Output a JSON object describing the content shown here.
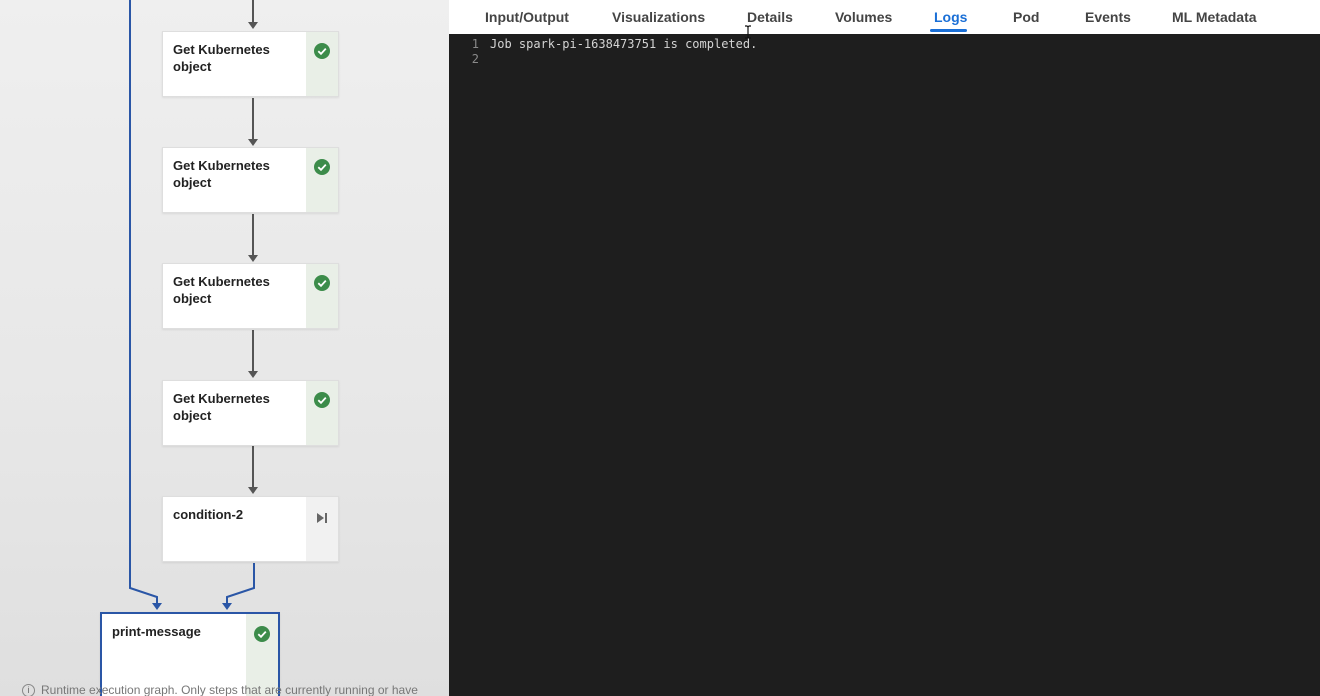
{
  "graph": {
    "nodes": [
      {
        "label": "Get Kubernetes object",
        "status": "succeeded"
      },
      {
        "label": "Get Kubernetes object",
        "status": "succeeded"
      },
      {
        "label": "Get Kubernetes object",
        "status": "succeeded"
      },
      {
        "label": "Get Kubernetes object",
        "status": "succeeded"
      },
      {
        "label": "condition-2",
        "status": "skipped"
      },
      {
        "label": "print-message",
        "status": "succeeded"
      }
    ],
    "footer_note": "Runtime execution graph. Only steps that are currently running or have"
  },
  "tabs": [
    {
      "label": "Input/Output"
    },
    {
      "label": "Visualizations"
    },
    {
      "label": "Details"
    },
    {
      "label": "Volumes"
    },
    {
      "label": "Logs",
      "active": true
    },
    {
      "label": "Pod"
    },
    {
      "label": "Events"
    },
    {
      "label": "ML Metadata"
    }
  ],
  "logs": {
    "lines": [
      {
        "num": "1",
        "text": "Job spark-pi-1638473751 is completed."
      },
      {
        "num": "2",
        "text": ""
      }
    ]
  },
  "colors": {
    "accent": "#1a6fd6",
    "success": "#3c8c4a",
    "edge": "#555555",
    "exit_edge": "#2a56a6",
    "log_bg": "#1e1e1e"
  }
}
